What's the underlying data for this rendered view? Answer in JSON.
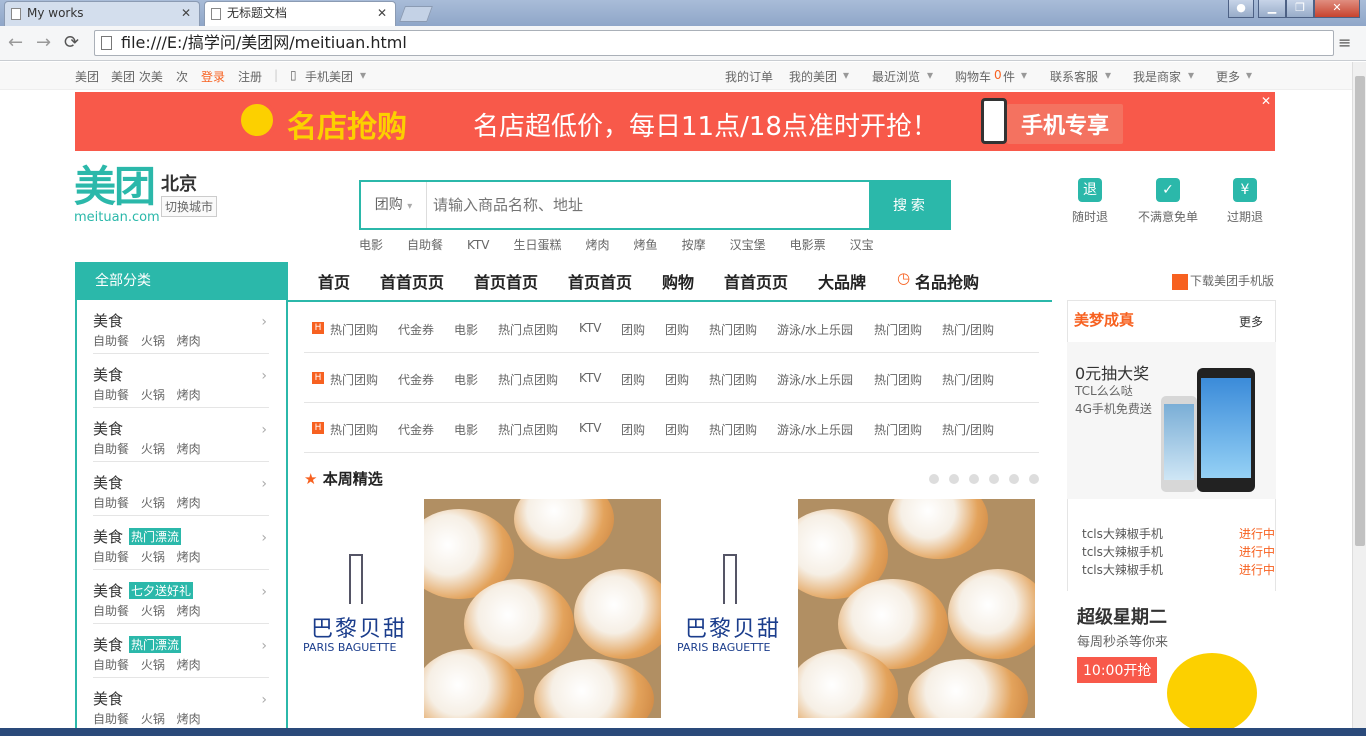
{
  "browser": {
    "tabs": [
      {
        "title": "My works"
      },
      {
        "title": "无标题文档"
      }
    ],
    "url": "file:///E:/搞学问/美团网/meitiuan.html"
  },
  "topbar": {
    "left": [
      "美团",
      "美团 次美",
      "次",
      "登录",
      "注册",
      "手机美团"
    ],
    "right": [
      "我的订单",
      "我的美团",
      "最近浏览",
      "购物车",
      "0",
      "件",
      "联系客服",
      "我是商家",
      "更多"
    ]
  },
  "banner": {
    "headline": "名店抢购",
    "text": "名店超低价，每日11点/18点准时开抢！",
    "mobile": "手机专享"
  },
  "header": {
    "logo": "美团",
    "logo_sub": "meituan.com",
    "city": "北京",
    "switch_city": "切换城市"
  },
  "search": {
    "category": "团购",
    "placeholder": "请输入商品名称、地址",
    "button": "搜 索",
    "hot": [
      "电影",
      "自助餐",
      "KTV",
      "生日蛋糕",
      "烤肉",
      "烤鱼",
      "按摩",
      "汉宝堡",
      "电影票",
      "汉宝"
    ]
  },
  "badges": [
    {
      "icon": "退",
      "label": "随时退"
    },
    {
      "icon": "✓",
      "label": "不满意免单"
    },
    {
      "icon": "¥",
      "label": "过期退"
    }
  ],
  "nav": {
    "all_categories": "全部分类",
    "items": [
      "首页",
      "首首页页",
      "首页首页",
      "首页首页",
      "购物",
      "首首页页",
      "大品牌",
      "名品抢购"
    ],
    "download": "下载美团手机版"
  },
  "categories": [
    {
      "title": "美食",
      "tag": "",
      "subs": "自助餐 火锅 烤肉"
    },
    {
      "title": "美食",
      "tag": "",
      "subs": "自助餐 火锅 烤肉"
    },
    {
      "title": "美食",
      "tag": "",
      "subs": "自助餐 火锅 烤肉"
    },
    {
      "title": "美食",
      "tag": "",
      "subs": "自助餐 火锅 烤肉"
    },
    {
      "title": "美食",
      "tag": "热门漂流",
      "subs": "自助餐 火锅 烤肉"
    },
    {
      "title": "美食",
      "tag": "七夕送好礼",
      "subs": "自助餐 火锅 烤肉"
    },
    {
      "title": "美食",
      "tag": "热门漂流",
      "subs": "自助餐 火锅 烤肉"
    },
    {
      "title": "美食",
      "tag": "",
      "subs": "自助餐 火锅 烤肉"
    }
  ],
  "content_links": [
    "热门团购",
    "代金券",
    "电影",
    "热门点团购",
    "KTV",
    "团购",
    "团购",
    "热门团购",
    "游泳/水上乐园",
    "热门团购",
    "热门/团购"
  ],
  "weekly": {
    "title": "本周精选"
  },
  "promo": {
    "brand_cn": "巴黎贝甜",
    "brand_en": "PARIS BAGUETTE"
  },
  "side": {
    "title": "美梦成真",
    "more": "更多",
    "prize_title": "0元抽大奖",
    "prize_sub1": "TCL么么哒",
    "prize_sub2": "4G手机免费送",
    "list": [
      {
        "name": "tcls大辣椒手机",
        "status": "进行中"
      },
      {
        "name": "tcls大辣椒手机",
        "status": "进行中"
      },
      {
        "name": "tcls大辣椒手机",
        "status": "进行中"
      }
    ],
    "tuesday_title": "超级星期二",
    "tuesday_sub": "每周秒杀等你来",
    "tuesday_btn": "10:00开抢"
  }
}
